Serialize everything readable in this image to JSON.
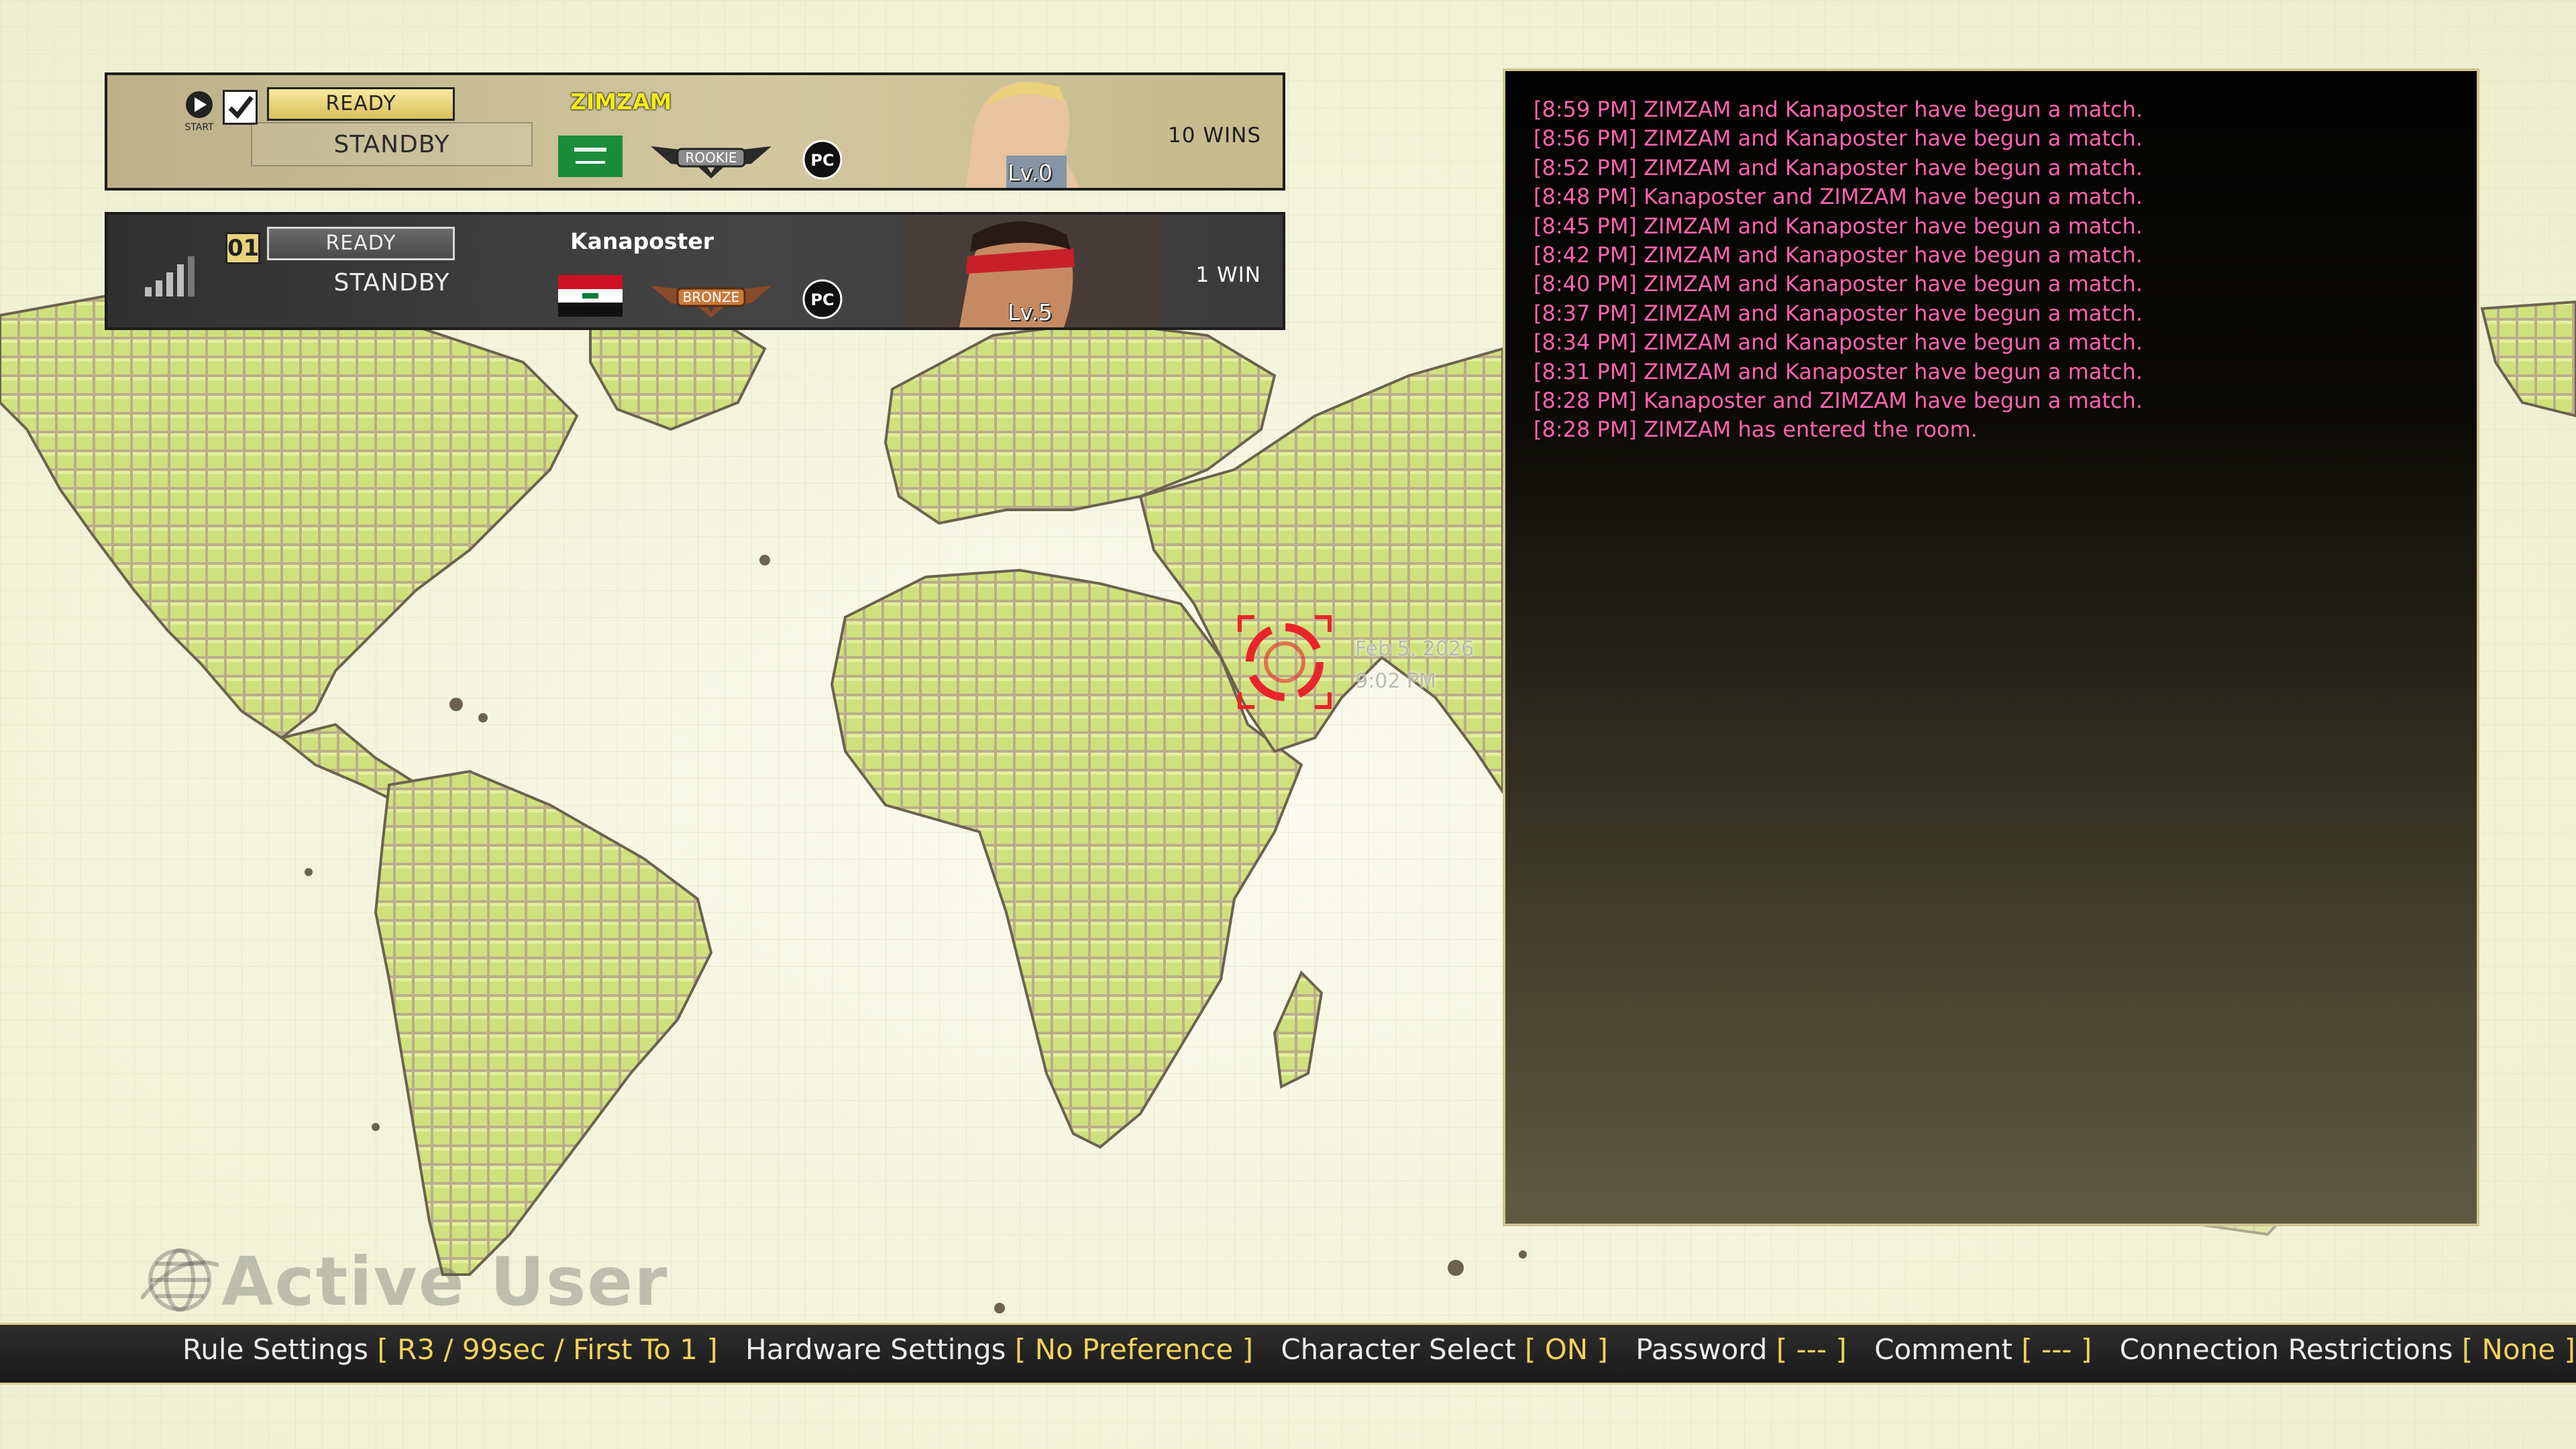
{
  "players": [
    {
      "name": "ZIMZAM",
      "ready_label": "READY",
      "standby_label": "STANDBY",
      "start_label": "START",
      "rank": "ROOKIE",
      "platform": "PC",
      "level": "Lv.0",
      "wins": "10 WINS",
      "flag": "saudi-arabia-flag",
      "ready_checked": true
    },
    {
      "name": "Kanaposter",
      "ready_label": "READY",
      "standby_label": "STANDBY",
      "slot": "01",
      "rank": "BRONZE",
      "platform": "PC",
      "level": "Lv.5",
      "wins": "1 WIN",
      "flag": "iraq-flag",
      "connection_bars": 4
    }
  ],
  "marker": {
    "date": "Feb 5, 2026",
    "time": "9:02 PM"
  },
  "log": [
    "[8:59 PM] ZIMZAM and Kanaposter have begun a match.",
    "[8:56 PM] ZIMZAM and Kanaposter have begun a match.",
    "[8:52 PM] ZIMZAM and Kanaposter have begun a match.",
    "[8:48 PM] Kanaposter and ZIMZAM have begun a match.",
    "[8:45 PM] ZIMZAM and Kanaposter have begun a match.",
    "[8:42 PM] ZIMZAM and Kanaposter have begun a match.",
    "[8:40 PM] ZIMZAM and Kanaposter have begun a match.",
    "[8:37 PM] ZIMZAM and Kanaposter have begun a match.",
    "[8:34 PM] ZIMZAM and Kanaposter have begun a match.",
    "[8:31 PM] ZIMZAM and Kanaposter have begun a match.",
    "[8:28 PM] Kanaposter and ZIMZAM have begun a match.",
    "[8:28 PM] ZIMZAM has entered the room."
  ],
  "watermark": "Active User",
  "settings": {
    "rule_label": "Rule Settings",
    "rule_value": "[ R3 / 99sec / First To 1 ]",
    "hardware_label": "Hardware Settings",
    "hardware_value": "[ No Preference ]",
    "charselect_label": "Character Select",
    "charselect_value": "[ ON ]",
    "password_label": "Password",
    "password_value": "[ --- ]",
    "comment_label": "Comment",
    "comment_value": "[ --- ]",
    "connection_label": "Connection Restrictions",
    "connection_value": "[ None ]"
  },
  "colors": {
    "log_text": "#ff63b0",
    "setting_value": "#f3d25a",
    "player1_name": "#f2ec18",
    "land_active": "#d4ec78",
    "land_inactive": "#b8ad8a",
    "marker": "#e8252a"
  }
}
